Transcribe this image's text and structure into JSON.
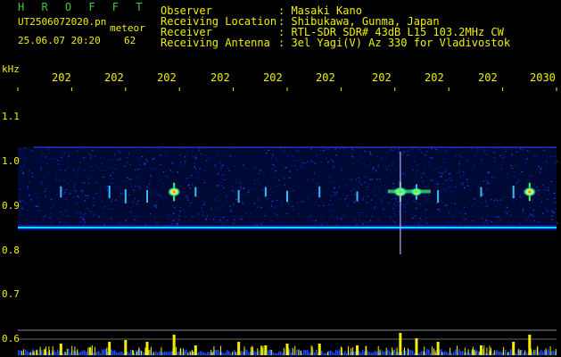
{
  "header": {
    "title": "H R O F F T",
    "file": "UT2506072020.pn",
    "meteor_label": "meteor",
    "datetime": "25.06.07 20:20",
    "count": "62",
    "meta": [
      {
        "label": "Observer",
        "value": ": Masaki Kano"
      },
      {
        "label": "Receiving Location",
        "value": ": Shibukawa, Gunma, Japan"
      },
      {
        "label": "Receiver",
        "value": ": RTL-SDR SDR# 43dB L15 103.2MHz CW"
      },
      {
        "label": "Receiving Antenna",
        "value": ": 3el Yagi(V) Az 330 for Vladivostok"
      }
    ]
  },
  "colors": {
    "header_green": "#3ec83e",
    "yellow": "#f0f000",
    "signal_blue": "#1a2aff",
    "cyan": "#00e0ff"
  },
  "chart_data": {
    "type": "heatmap",
    "ylabel": "kHz",
    "y_ticks": [
      "1.1",
      "1.0",
      "0.9",
      "0.8",
      "0.7",
      "0.6"
    ],
    "ylim": [
      0.6,
      1.1
    ],
    "x_ticks": [
      "202",
      "202",
      "202",
      "202",
      "202",
      "202",
      "202",
      "202",
      "202",
      "2030"
    ],
    "x_range_minutes": [
      2020,
      2030
    ],
    "carrier_freq_khz": 0.85,
    "noise_band_khz": [
      0.85,
      1.03
    ],
    "meteor_echoes": [
      {
        "time": 2020.8,
        "freq_khz": 0.93,
        "strength": 0.4
      },
      {
        "time": 2021.7,
        "freq_khz": 0.93,
        "strength": 0.5
      },
      {
        "time": 2022.0,
        "freq_khz": 0.92,
        "strength": 0.6
      },
      {
        "time": 2022.4,
        "freq_khz": 0.92,
        "strength": 0.5
      },
      {
        "time": 2022.9,
        "freq_khz": 0.93,
        "strength": 0.9
      },
      {
        "time": 2023.3,
        "freq_khz": 0.93,
        "strength": 0.3
      },
      {
        "time": 2024.1,
        "freq_khz": 0.92,
        "strength": 0.5
      },
      {
        "time": 2024.6,
        "freq_khz": 0.93,
        "strength": 0.3
      },
      {
        "time": 2025.0,
        "freq_khz": 0.92,
        "strength": 0.4
      },
      {
        "time": 2025.6,
        "freq_khz": 0.93,
        "strength": 0.4
      },
      {
        "time": 2026.3,
        "freq_khz": 0.92,
        "strength": 0.3
      },
      {
        "time": 2027.1,
        "freq_khz": 0.93,
        "strength": 1.0
      },
      {
        "time": 2027.4,
        "freq_khz": 0.93,
        "strength": 0.7
      },
      {
        "time": 2027.8,
        "freq_khz": 0.92,
        "strength": 0.5
      },
      {
        "time": 2028.6,
        "freq_khz": 0.93,
        "strength": 0.3
      },
      {
        "time": 2029.2,
        "freq_khz": 0.93,
        "strength": 0.5
      },
      {
        "time": 2029.5,
        "freq_khz": 0.93,
        "strength": 0.9
      }
    ]
  }
}
